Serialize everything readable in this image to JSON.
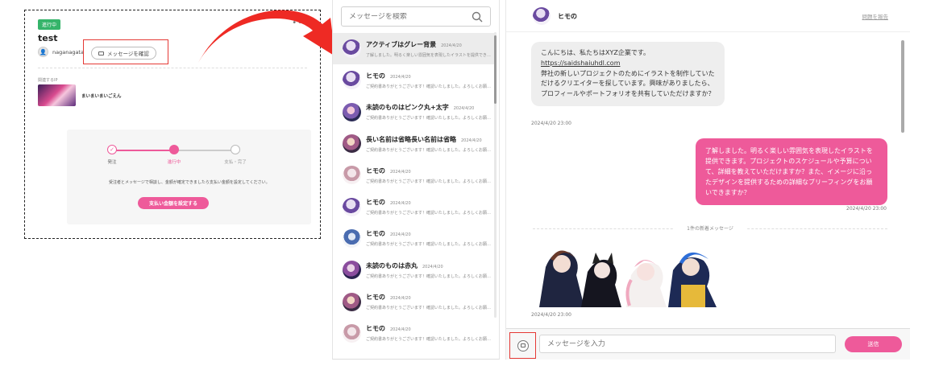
{
  "card": {
    "status_badge": "進行中",
    "title": "test",
    "user_name": "naganagata",
    "message_button": "メッセージを確認",
    "related_label": "関連するIP",
    "related_title": "まいまいまいごえん",
    "steps": [
      "発注",
      "進行中",
      "支払・完了"
    ],
    "note": "受注者とメッセージで相談し、金額が確定できましたら支払い金額を設定してください。",
    "pay_button": "支払い金額を設定する"
  },
  "search": {
    "placeholder": "メッセージを検索"
  },
  "list": [
    {
      "name": "アクティブはグレー背景",
      "date": "2024/4/20",
      "preview": "了解しました。明るく楽しい雰囲気を表現したイラストを提供できます。",
      "active": true
    },
    {
      "name": "ヒモの",
      "date": "2024/4/20",
      "preview": "ご契約書ありがとうございます！確認いたしました。よろしくお願いします",
      "active": false
    },
    {
      "name": "未読のものはピンク丸+太字",
      "date": "2024/4/20",
      "preview": "ご契約書ありがとうございます！確認いたしました。よろしくお願いします",
      "active": false
    },
    {
      "name": "長い名前は省略長い名前は省略",
      "date": "2024/4/20",
      "preview": "ご契約書ありがとうございます！確認いたしました。よろしくお願いします",
      "active": false
    },
    {
      "name": "ヒモの",
      "date": "2024/4/20",
      "preview": "ご契約書ありがとうございます！確認いたしました。よろしくお願いします",
      "active": false
    },
    {
      "name": "ヒモの",
      "date": "2024/4/20",
      "preview": "ご契約書ありがとうございます！確認いたしました。よろしくお願いします",
      "active": false
    },
    {
      "name": "ヒモの",
      "date": "2024/4/20",
      "preview": "ご契約書ありがとうございます！確認いたしました。よろしくお願いします",
      "active": false
    },
    {
      "name": "未読のものは赤丸",
      "date": "2024/4/20",
      "preview": "ご契約書ありがとうございます！確認いたしました。よろしくお願いします",
      "active": false
    },
    {
      "name": "ヒモの",
      "date": "2024/4/20",
      "preview": "ご契約書ありがとうございます！確認いたしました。よろしくお願いします",
      "active": false
    },
    {
      "name": "ヒモの",
      "date": "2024/4/20",
      "preview": "ご契約書ありがとうございます！確認いたしました。よろしくお願いします",
      "active": false
    }
  ],
  "chat": {
    "header_name": "ヒモの",
    "report_link": "問題を報告",
    "incoming_1": "こんにちは、私たちはXYZ企業です。",
    "incoming_link": "https://saidshaiuhdl.com",
    "incoming_2": "弊社の新しいプロジェクトのためにイラストを制作していただけるクリエイターを探しています。興味がありましたら、プロフィールやポートフォリオを共有していただけますか？",
    "incoming_time": "2024/4/20 23:00",
    "outgoing": "了解しました。明るく楽しい雰囲気を表現したイラストを提供できます。プロジェクトのスケジュールや予算について、詳細を教えていただけますか？また、イメージに沿ったデザインを提供するための詳細なブリーフィングをお願いできますか？",
    "outgoing_time": "2024/4/20 23:00",
    "new_separator": "1件の新着メッセージ",
    "image_time": "2024/4/20 23:00",
    "input_placeholder": "メッセージを入力",
    "send_label": "送信"
  },
  "colors": {
    "accent": "#ee5a9a",
    "badge": "#35b46a",
    "highlight": "#e53935"
  }
}
